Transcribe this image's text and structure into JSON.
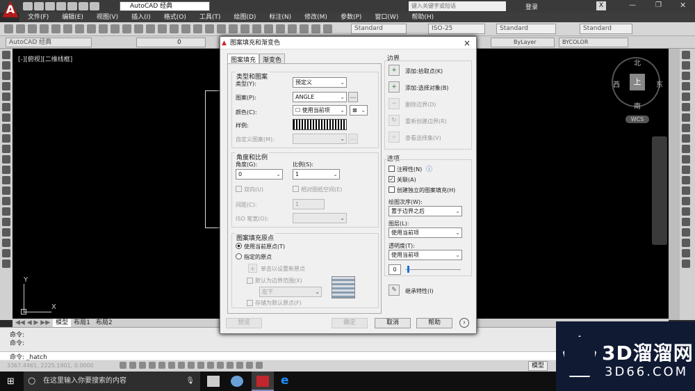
{
  "titlebar": {
    "workspace": "AutoCAD 经典",
    "search_placeholder": "键入关键字或短语",
    "login": "登录"
  },
  "menubar": {
    "items": [
      "文件(F)",
      "编辑(E)",
      "视图(V)",
      "插入(I)",
      "格式(O)",
      "工具(T)",
      "绘图(D)",
      "标注(N)",
      "修改(M)",
      "参数(P)",
      "窗口(W)",
      "帮助(H)"
    ]
  },
  "toolbar": {
    "text_style": "Standard",
    "dim_style": "ISO-25",
    "table_style": "Standard",
    "mleader_style": "Standard"
  },
  "props_bar": {
    "workspace": "AutoCAD 经典",
    "layer": "0",
    "linetype": "ByLayer",
    "color": "BYCOLOR"
  },
  "viewport": {
    "label": "[-][俯视][二维线框]",
    "north": "北",
    "south": "南",
    "east": "东",
    "west": "西",
    "top": "上",
    "wcs": "WCS",
    "axis_y": "Y",
    "axis_x": "X"
  },
  "layout_tabs": [
    "模型",
    "布局1",
    "布局2"
  ],
  "command": {
    "line1": "命令:",
    "line2": "命令:",
    "current": "命令: _hatch"
  },
  "statusbar": {
    "coords": "3367.4461, 2225.1901, 0.0000",
    "model": "模型"
  },
  "dialog": {
    "title": "图案填充和渐变色",
    "close": "×",
    "tabs": [
      "图案填充",
      "渐变色"
    ],
    "type_pattern": {
      "title": "类型和图案",
      "type_label": "类型(Y):",
      "type_value": "预定义",
      "pattern_label": "图案(P):",
      "pattern_value": "ANGLE",
      "color_label": "颜色(C):",
      "color_value": "使用当前项",
      "swatch_label": "样例:",
      "custom_label": "自定义图案(M):"
    },
    "angle_scale": {
      "title": "角度和比例",
      "angle_label": "角度(G):",
      "angle_value": "0",
      "scale_label": "比例(S):",
      "scale_value": "1",
      "double_label": "双向(U)",
      "relative_label": "相对图纸空间(E)",
      "spacing_label": "间距(C):",
      "spacing_value": "1",
      "iso_label": "ISO 笔宽(O):"
    },
    "origin": {
      "title": "图案填充原点",
      "use_current": "使用当前原点(T)",
      "specified": "指定的原点",
      "click_set": "单击以设置新原点",
      "default_extent": "默认为边界范围(X)",
      "extent_value": "左下",
      "store_default": "存储为默认原点(F)"
    },
    "boundary": {
      "title": "边界",
      "add_pick": "添加:拾取点(K)",
      "add_select": "添加:选择对象(B)",
      "remove": "删除边界(D)",
      "recreate": "重新创建边界(R)",
      "view_sel": "查看选择集(V)"
    },
    "options": {
      "title": "选项",
      "annotative": "注释性(N)",
      "associative": "关联(A)",
      "separate": "创建独立的图案填充(H)",
      "draw_order_label": "绘图次序(W):",
      "draw_order_value": "置于边界之后",
      "layer_label": "图层(L):",
      "layer_value": "使用当前项",
      "transparency_label": "透明度(T):",
      "transparency_value": "使用当前项",
      "transparency_num": "0"
    },
    "inherit": "继承特性(I)",
    "buttons": {
      "preview": "预览",
      "ok": "确定",
      "cancel": "取消",
      "help": "帮助"
    }
  },
  "taskbar": {
    "search": "在这里输入你要搜索的内容"
  },
  "watermark": {
    "brand": "3D溜溜网",
    "url": "3D66.COM"
  }
}
